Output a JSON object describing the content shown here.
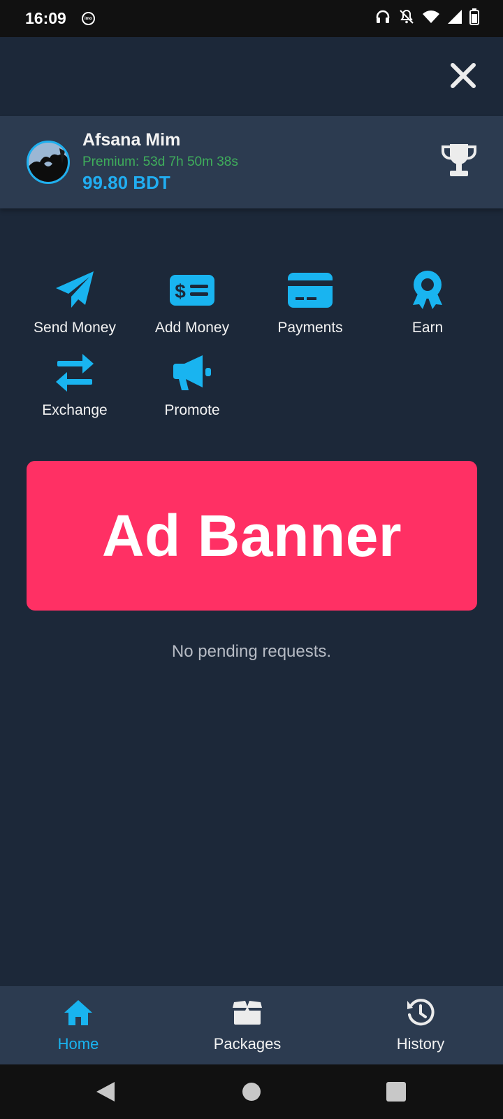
{
  "status_bar": {
    "time": "16:09",
    "imo_label": "imo",
    "icons": [
      "imo-icon",
      "headphones-icon",
      "notifications-off-icon",
      "wifi-icon",
      "signal-icon",
      "battery-icon"
    ]
  },
  "header": {
    "close_icon": "close-icon"
  },
  "profile": {
    "name": "Afsana Mim",
    "premium": "Premium: 53d 7h 50m 38s",
    "balance": "99.80 BDT",
    "trophy_icon": "trophy-icon"
  },
  "actions": [
    {
      "label": "Send Money",
      "icon": "paper-plane-icon"
    },
    {
      "label": "Add Money",
      "icon": "money-bill-icon"
    },
    {
      "label": "Payments",
      "icon": "credit-card-icon"
    },
    {
      "label": "Earn",
      "icon": "award-icon"
    },
    {
      "label": "Exchange",
      "icon": "exchange-icon"
    },
    {
      "label": "Promote",
      "icon": "megaphone-icon"
    }
  ],
  "ad_banner": {
    "text": "Ad Banner"
  },
  "requests": {
    "empty_text": "No pending requests."
  },
  "bottom_nav": {
    "items": [
      {
        "label": "Home",
        "icon": "home-icon",
        "active": true
      },
      {
        "label": "Packages",
        "icon": "box-icon",
        "active": false
      },
      {
        "label": "History",
        "icon": "history-icon",
        "active": false
      }
    ]
  },
  "colors": {
    "background": "#1c2839",
    "card": "#2c3b50",
    "accent": "#21aef2",
    "premium_green": "#3fae5b",
    "ad_banner": "#ff3064"
  }
}
